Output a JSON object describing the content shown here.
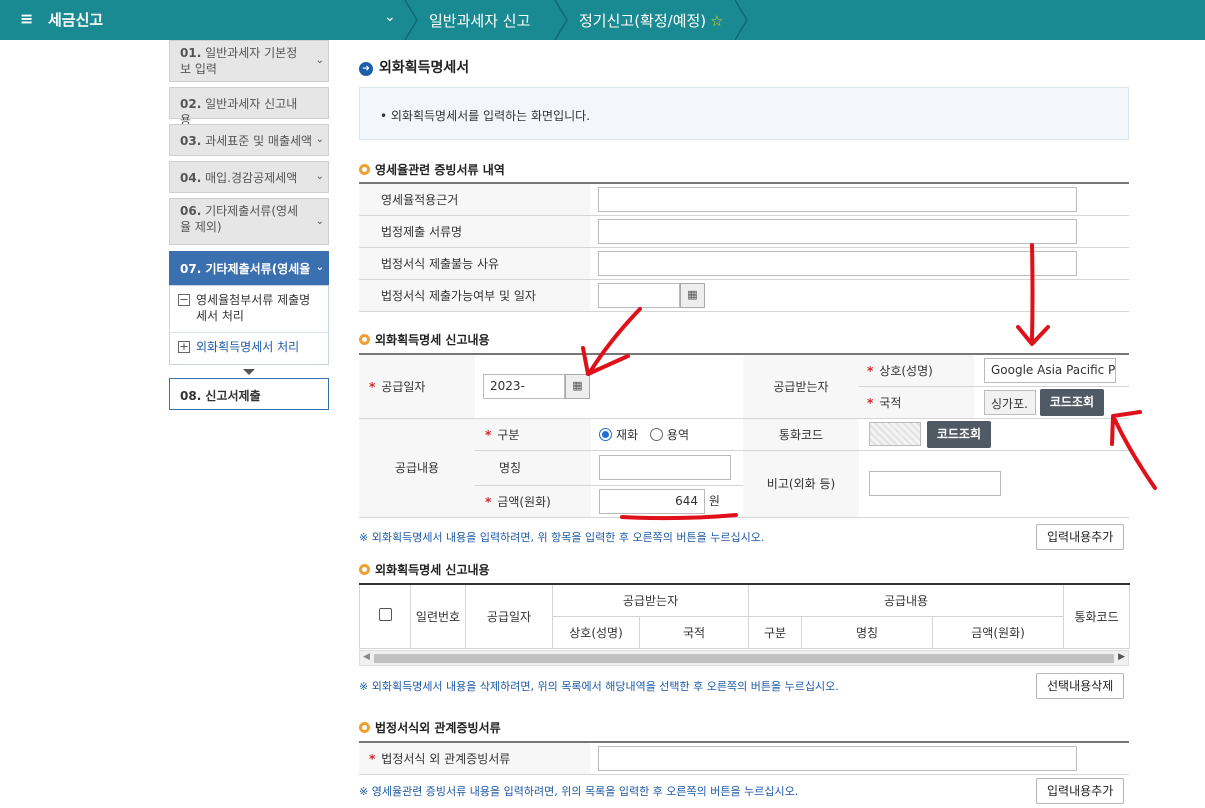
{
  "header": {
    "menu_icon": "≡",
    "title": "세금신고",
    "chevron": "⌄",
    "crumb1": "일반과세자 신고",
    "crumb2": "정기신고(확정/예정)",
    "star": "☆"
  },
  "nav": {
    "items": [
      {
        "num": "01.",
        "label": "일반과세자 기본정보 입력"
      },
      {
        "num": "02.",
        "label": "일반과세자 신고내용"
      },
      {
        "num": "03.",
        "label": "과세표준 및 매출세액"
      },
      {
        "num": "04.",
        "label": "매입.경감공제세액"
      },
      {
        "num": "06.",
        "label": "기타제출서류(영세율 제외)"
      },
      {
        "num": "07.",
        "label": "기타제출서류(영세율"
      }
    ],
    "subitems": [
      {
        "icon": "−",
        "label": "영세율첨부서류 제출명세서 처리"
      },
      {
        "icon": "+",
        "label": "외화획득명세서 처리"
      }
    ],
    "submit": "08. 신고서제출"
  },
  "page_title": "외화획득명세서",
  "info_text": "• 외화획득명세서를 입력하는 화면입니다.",
  "section1": {
    "title": "영세율관련 증빙서류 내역",
    "rows": [
      "영세율적용근거",
      "법정제출 서류명",
      "법정서식 제출불능 사유",
      "법정서식 제출가능여부 및 일자"
    ]
  },
  "section2": {
    "title": "외화획득명세 신고내용",
    "supply_date_label": "공급일자",
    "supply_date_value": "2023-",
    "receiver_label": "공급받는자",
    "company_label": "상호(성명)",
    "company_value": "Google Asia Pacific P",
    "country_label": "국적",
    "country_value": "싱가포.",
    "code_lookup": "코드조회",
    "supply_content_label": "공급내용",
    "type_label": "구분",
    "type_goods": "재화",
    "type_service": "용역",
    "currency_label": "통화코드",
    "name_label": "명칭",
    "amount_label": "금액(원화)",
    "amount_value": "644",
    "unit": "원",
    "remark_label": "비고(외화 등)",
    "note": "※ 외화획득명세서 내용을 입력하려면, 위 항목을 입력한 후 오른쪽의 버튼을 누르십시오.",
    "add_button": "입력내용추가"
  },
  "section3": {
    "title": "외화획득명세 신고내용",
    "headers": {
      "serial": "일련번호",
      "date": "공급일자",
      "receiver": "공급받는자",
      "content": "공급내용",
      "currency": "통화코드",
      "company": "상호(성명)",
      "country": "국적",
      "type": "구분",
      "name": "명칭",
      "amount": "금액(원화)"
    },
    "note": "※ 외화획득명세서 내용을 삭제하려면, 위의 목록에서 해당내역을 선택한 후 오른쪽의 버튼을 누르십시오.",
    "delete_button": "선택내용삭제"
  },
  "section4": {
    "title": "법정서식외 관계증빙서류",
    "row_label": "법정서식 외 관계증빙서류",
    "note": "※ 영세율관련 증빙서류 내용을 입력하려면, 위의 목록을 입력한 후 오른쪽의 버튼을 누르십시오.",
    "add_button": "입력내용추가"
  },
  "colors": {
    "header": "#1a8a92",
    "nav_active": "#3a6fb0",
    "annotation": "#e0101a"
  }
}
